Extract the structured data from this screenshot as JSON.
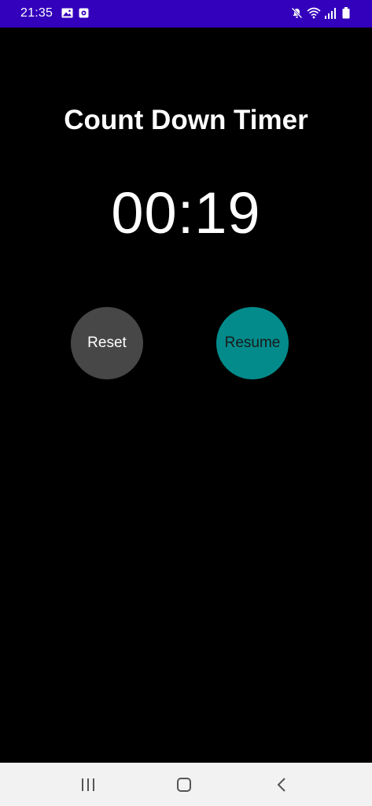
{
  "status_bar": {
    "time": "21:35",
    "background_color": "#3300bb",
    "left_icons": [
      "gallery-icon",
      "notification-icon"
    ],
    "right_icons": [
      "mute-icon",
      "wifi-icon",
      "signal-icon",
      "battery-icon"
    ]
  },
  "main": {
    "title": "Count Down Timer",
    "timer_display": "00:19",
    "buttons": {
      "reset_label": "Reset",
      "resume_label": "Resume"
    },
    "colors": {
      "background": "#000000",
      "reset_button": "#474747",
      "resume_button": "#038b8b"
    }
  },
  "nav_bar": {
    "icons": [
      "recents-icon",
      "home-icon",
      "back-icon"
    ],
    "background_color": "#f2f2f2"
  }
}
